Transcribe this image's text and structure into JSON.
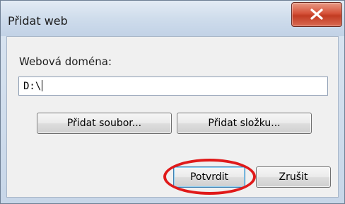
{
  "window": {
    "title": "Přidat web"
  },
  "titlebar": {
    "close_icon": "close-x-icon",
    "close_color": "#c23b22"
  },
  "form": {
    "domain_label": "Webová doména:",
    "domain_value": "D:\\"
  },
  "buttons": {
    "add_file": "Přidat soubor...",
    "add_folder": "Přidat složku...",
    "confirm": "Potvrdit",
    "cancel": "Zrušit"
  },
  "annotation": {
    "highlight_target": "confirm",
    "highlight_color": "#e01a1a"
  }
}
